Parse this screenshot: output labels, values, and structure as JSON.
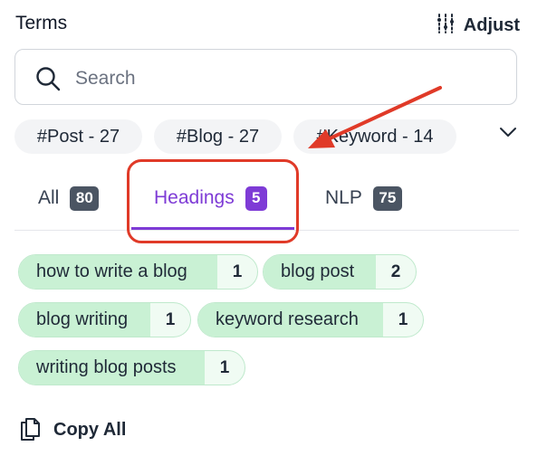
{
  "header": {
    "title": "Terms",
    "adjust_label": "Adjust",
    "adjust_icon": "sliders-icon"
  },
  "search": {
    "placeholder": "Search",
    "value": "",
    "icon": "search-icon"
  },
  "filters": [
    "#Post - 27",
    "#Blog - 27",
    "#Keyword - 14"
  ],
  "tabs": [
    {
      "label": "All",
      "count": "80",
      "active": false
    },
    {
      "label": "Headings",
      "count": "5",
      "active": true
    },
    {
      "label": "NLP",
      "count": "75",
      "active": false
    }
  ],
  "terms": [
    {
      "text": "how to write a blog",
      "count": "1"
    },
    {
      "text": "blog post",
      "count": "2"
    },
    {
      "text": "blog writing",
      "count": "1"
    },
    {
      "text": "keyword research",
      "count": "1"
    },
    {
      "text": "writing blog posts",
      "count": "1"
    }
  ],
  "copy_all": {
    "label": "Copy All",
    "icon": "copy-icon"
  },
  "colors": {
    "accent": "#7e3bd6",
    "annotation": "#e03a28",
    "term_bg": "#c9f1d4",
    "term_border": "#bfe9cc",
    "badge": "#4b5563"
  }
}
